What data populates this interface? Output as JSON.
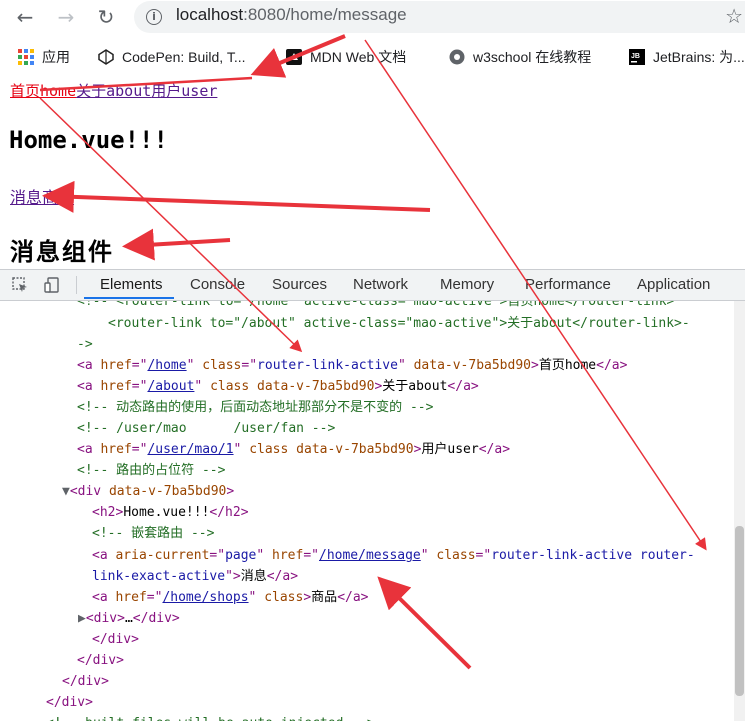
{
  "browser": {
    "url_host": "localhost",
    "url_rest": ":8080/home/message",
    "back_icon": "arrow-left-icon",
    "forward_icon": "arrow-right-icon",
    "reload_icon": "reload-icon",
    "star_icon": "star-icon"
  },
  "bookmarks": [
    {
      "label": "应用",
      "icon": "apps-grid-icon"
    },
    {
      "label": "CodePen: Build, T...",
      "icon": "codepen-icon"
    },
    {
      "label": "MDN Web 文档",
      "icon": "mdn-icon"
    },
    {
      "label": "w3school 在线教程",
      "icon": "w3school-icon"
    },
    {
      "label": "JetBrains: 为...",
      "icon": "jetbrains-icon"
    }
  ],
  "page": {
    "nav_home": "首页home",
    "nav_about": "关于about",
    "nav_user": "用户user",
    "heading": "Home.vue!!!",
    "message_link": "消息",
    "shops_link": "商品",
    "message_component": "消息组件"
  },
  "devtools": {
    "tabs": [
      "Elements",
      "Console",
      "Sources",
      "Network",
      "Memory",
      "Performance",
      "Application"
    ],
    "active_tab": "Elements",
    "code": {
      "l0": "<!-- <router-link to=\"/home\" active-class=\"mao-active\">首页home</router-link>",
      "l1": "<router-link to=\"/about\" active-class=\"mao-active\">关于about</router-link>-",
      "l2": "->",
      "l3_href": "/home",
      "l3_class": "router-link-active",
      "l3_dv": "data-v-7ba5bd90",
      "l3_text": "首页home",
      "l4_href": "/about",
      "l4_text": "关于about",
      "l5": "<!-- 动态路由的使用，后面动态地址那部分不是不变的 -->",
      "l6": "<!-- /user/mao      /user/fan -->",
      "l7_href": "/user/mao/1",
      "l7_text": "用户user",
      "l8": "<!-- 路由的占位符 -->",
      "l9_dv": "data-v-7ba5bd90",
      "l10_text": "Home.vue!!!",
      "l11": "<!-- 嵌套路由 -->",
      "l12_aria": "page",
      "l12_href": "/home/message",
      "l12_class": "router-link-active router-",
      "l13_class": "link-exact-active",
      "l13_text": "消息",
      "l14_href": "/home/shops",
      "l14_text": "商品",
      "l15": "…",
      "l19": "<!-- built files will be auto injected -->"
    }
  },
  "colors": {
    "active_link": "#e60012",
    "annotation_arrow": "#e8333b"
  }
}
